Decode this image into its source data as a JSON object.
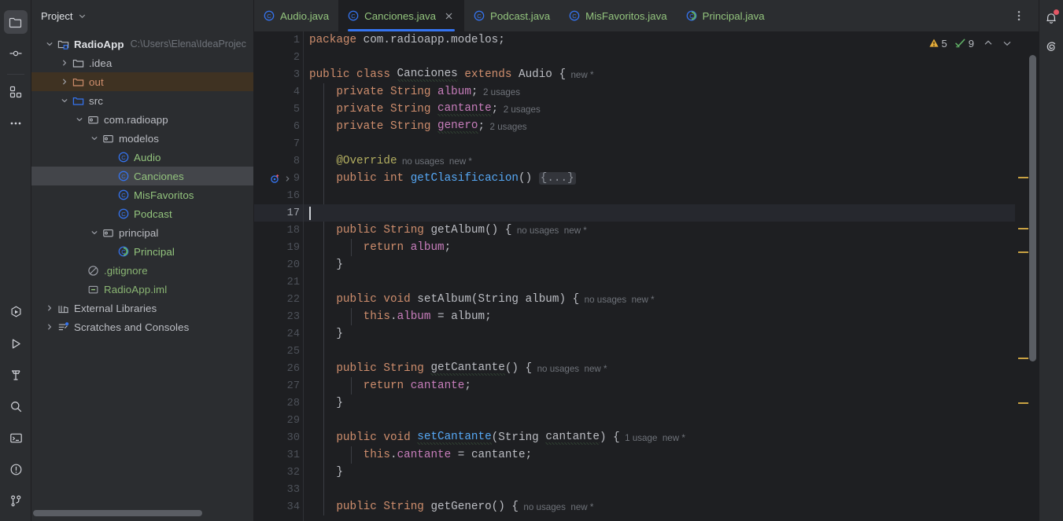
{
  "activity_bar": {
    "top": [
      {
        "name": "project-icon",
        "label": "Project"
      },
      {
        "name": "commit-icon",
        "label": "Commit"
      },
      {
        "name": "plugins-icon",
        "label": "Plugins"
      },
      {
        "name": "more-tool-windows-icon",
        "label": "More Tool Windows"
      }
    ],
    "bottom": [
      {
        "name": "run-with-coverage-icon",
        "label": "Run with Coverage"
      },
      {
        "name": "run-icon",
        "label": "Run"
      },
      {
        "name": "build-icon",
        "label": "Build"
      },
      {
        "name": "search-everywhere-icon",
        "label": "Search"
      },
      {
        "name": "terminal-icon",
        "label": "Terminal"
      },
      {
        "name": "problems-icon",
        "label": "Problems"
      },
      {
        "name": "version-control-icon",
        "label": "Version Control"
      }
    ]
  },
  "project_panel": {
    "title": "Project",
    "tree": [
      {
        "depth": 0,
        "arrow": "down",
        "icon": "module-icon",
        "label": "RadioApp",
        "style": "bold",
        "path": "C:\\Users\\Elena\\IdeaProjec",
        "state": "normal"
      },
      {
        "depth": 1,
        "arrow": "right",
        "icon": "folder-icon",
        "label": ".idea",
        "style": "plain",
        "state": "normal"
      },
      {
        "depth": 1,
        "arrow": "right",
        "icon": "folder-orange-icon",
        "label": "out",
        "style": "orange",
        "state": "highlight"
      },
      {
        "depth": 1,
        "arrow": "down",
        "icon": "folder-blue-icon",
        "label": "src",
        "style": "plain",
        "state": "normal"
      },
      {
        "depth": 2,
        "arrow": "down",
        "icon": "package-icon",
        "label": "com.radioapp",
        "style": "plain",
        "state": "normal"
      },
      {
        "depth": 3,
        "arrow": "down",
        "icon": "package-icon",
        "label": "modelos",
        "style": "plain",
        "state": "normal"
      },
      {
        "depth": 4,
        "arrow": "none",
        "icon": "class-icon",
        "label": "Audio",
        "style": "green",
        "state": "normal"
      },
      {
        "depth": 4,
        "arrow": "none",
        "icon": "class-icon",
        "label": "Canciones",
        "style": "green",
        "state": "selected"
      },
      {
        "depth": 4,
        "arrow": "none",
        "icon": "class-icon",
        "label": "MisFavoritos",
        "style": "green",
        "state": "normal"
      },
      {
        "depth": 4,
        "arrow": "none",
        "icon": "class-icon",
        "label": "Podcast",
        "style": "green",
        "state": "normal"
      },
      {
        "depth": 3,
        "arrow": "down",
        "icon": "package-icon",
        "label": "principal",
        "style": "plain",
        "state": "normal"
      },
      {
        "depth": 4,
        "arrow": "none",
        "icon": "runnable-class-icon",
        "label": "Principal",
        "style": "green",
        "state": "normal"
      },
      {
        "depth": 2,
        "arrow": "none",
        "icon": "gitignore-icon",
        "label": ".gitignore",
        "style": "green2",
        "state": "normal"
      },
      {
        "depth": 2,
        "arrow": "none",
        "icon": "iml-icon",
        "label": "RadioApp.iml",
        "style": "green2",
        "state": "normal"
      },
      {
        "depth": 0,
        "arrow": "right",
        "icon": "libraries-icon",
        "label": "External Libraries",
        "style": "plain",
        "state": "normal"
      },
      {
        "depth": 0,
        "arrow": "right",
        "icon": "scratches-icon",
        "label": "Scratches and Consoles",
        "style": "plain",
        "state": "normal"
      }
    ]
  },
  "editor": {
    "tabs": [
      {
        "label": "Audio.java",
        "icon": "class-icon",
        "active": false,
        "closable": false
      },
      {
        "label": "Canciones.java",
        "icon": "class-icon",
        "active": true,
        "closable": true
      },
      {
        "label": "Podcast.java",
        "icon": "class-icon",
        "active": false,
        "closable": false
      },
      {
        "label": "MisFavoritos.java",
        "icon": "class-icon",
        "active": false,
        "closable": false
      },
      {
        "label": "Principal.java",
        "icon": "runnable-class-icon",
        "active": false,
        "closable": false
      }
    ],
    "more_tabs_label": "⋮",
    "inspections": {
      "warning_count": "5",
      "weak_warning_count": "9",
      "prev_label": "Previous highlighted error",
      "next_label": "Next highlighted error"
    },
    "current_line": 17,
    "lines": [
      {
        "n": "1",
        "tokens": [
          {
            "t": "package ",
            "c": "kw"
          },
          {
            "t": "com.radioapp.modelos;",
            "c": "pl"
          }
        ]
      },
      {
        "n": "2",
        "tokens": []
      },
      {
        "n": "3",
        "tokens": [
          {
            "t": "public class ",
            "c": "kw"
          },
          {
            "t": "Canciones",
            "c": "pl",
            "squiggle": true
          },
          {
            "t": " extends ",
            "c": "kw"
          },
          {
            "t": "Audio {",
            "c": "pl"
          },
          {
            "t": "  new *",
            "c": "hint"
          }
        ]
      },
      {
        "n": "4",
        "indent": 1,
        "tokens": [
          {
            "t": "    private String ",
            "c": "kw"
          },
          {
            "t": "album",
            "c": "fld"
          },
          {
            "t": ";",
            "c": "pl"
          },
          {
            "t": "  2 usages",
            "c": "hint"
          }
        ]
      },
      {
        "n": "5",
        "indent": 1,
        "tokens": [
          {
            "t": "    private String ",
            "c": "kw"
          },
          {
            "t": "cantante",
            "c": "fld",
            "squiggle": true
          },
          {
            "t": ";",
            "c": "pl"
          },
          {
            "t": "  2 usages",
            "c": "hint"
          }
        ]
      },
      {
        "n": "6",
        "indent": 1,
        "tokens": [
          {
            "t": "    private String ",
            "c": "kw"
          },
          {
            "t": "genero",
            "c": "fld",
            "squiggle": true
          },
          {
            "t": ";",
            "c": "pl"
          },
          {
            "t": "  2 usages",
            "c": "hint"
          }
        ]
      },
      {
        "n": "7",
        "indent": 1,
        "tokens": []
      },
      {
        "n": "8",
        "indent": 1,
        "tokens": [
          {
            "t": "    @Override",
            "c": "anno"
          },
          {
            "t": "  no usages  new *",
            "c": "hint"
          }
        ]
      },
      {
        "n": "9",
        "indent": 1,
        "gutter_icon": "override-method-icon",
        "fold": true,
        "tokens": [
          {
            "t": "    public int ",
            "c": "kw"
          },
          {
            "t": "getClasificacion",
            "c": "fn"
          },
          {
            "t": "() ",
            "c": "pl"
          },
          {
            "t": "{...}",
            "c": "foldmark"
          }
        ]
      },
      {
        "n": "16",
        "indent": 1,
        "tokens": []
      },
      {
        "n": "17",
        "indent": 0,
        "caret": true,
        "tokens": []
      },
      {
        "n": "18",
        "indent": 1,
        "tokens": [
          {
            "t": "    public String ",
            "c": "kw"
          },
          {
            "t": "getAlbum",
            "c": "fnd"
          },
          {
            "t": "() {",
            "c": "pl"
          },
          {
            "t": "  no usages  new *",
            "c": "hint"
          }
        ]
      },
      {
        "n": "19",
        "indent": 2,
        "tokens": [
          {
            "t": "        return ",
            "c": "kw"
          },
          {
            "t": "album",
            "c": "fld"
          },
          {
            "t": ";",
            "c": "pl"
          }
        ]
      },
      {
        "n": "20",
        "indent": 1,
        "tokens": [
          {
            "t": "    }",
            "c": "pl"
          }
        ]
      },
      {
        "n": "21",
        "indent": 1,
        "tokens": []
      },
      {
        "n": "22",
        "indent": 1,
        "tokens": [
          {
            "t": "    public void ",
            "c": "kw"
          },
          {
            "t": "setAlbum",
            "c": "fnd"
          },
          {
            "t": "(",
            "c": "pl"
          },
          {
            "t": "String album",
            "c": "pl"
          },
          {
            "t": ") {",
            "c": "pl"
          },
          {
            "t": "  no usages  new *",
            "c": "hint"
          }
        ]
      },
      {
        "n": "23",
        "indent": 2,
        "tokens": [
          {
            "t": "        this",
            "c": "kw"
          },
          {
            "t": ".",
            "c": "pl"
          },
          {
            "t": "album",
            "c": "fld"
          },
          {
            "t": " = album;",
            "c": "pl"
          }
        ]
      },
      {
        "n": "24",
        "indent": 1,
        "tokens": [
          {
            "t": "    }",
            "c": "pl"
          }
        ]
      },
      {
        "n": "25",
        "indent": 1,
        "tokens": []
      },
      {
        "n": "26",
        "indent": 1,
        "tokens": [
          {
            "t": "    public String ",
            "c": "kw"
          },
          {
            "t": "getCantante",
            "c": "fnd",
            "squiggle": true
          },
          {
            "t": "() {",
            "c": "pl"
          },
          {
            "t": "  no usages  new *",
            "c": "hint"
          }
        ]
      },
      {
        "n": "27",
        "indent": 2,
        "tokens": [
          {
            "t": "        return ",
            "c": "kw"
          },
          {
            "t": "cantante",
            "c": "fld"
          },
          {
            "t": ";",
            "c": "pl"
          }
        ]
      },
      {
        "n": "28",
        "indent": 1,
        "tokens": [
          {
            "t": "    }",
            "c": "pl"
          }
        ]
      },
      {
        "n": "29",
        "indent": 1,
        "tokens": []
      },
      {
        "n": "30",
        "indent": 1,
        "tokens": [
          {
            "t": "    public void ",
            "c": "kw"
          },
          {
            "t": "setCantante",
            "c": "fn",
            "squiggle": true
          },
          {
            "t": "(",
            "c": "pl"
          },
          {
            "t": "String ",
            "c": "pl"
          },
          {
            "t": "cantante",
            "c": "pl",
            "squiggle": true
          },
          {
            "t": ") {",
            "c": "pl"
          },
          {
            "t": "  1 usage  new *",
            "c": "hint"
          }
        ]
      },
      {
        "n": "31",
        "indent": 2,
        "tokens": [
          {
            "t": "        this",
            "c": "kw"
          },
          {
            "t": ".",
            "c": "pl"
          },
          {
            "t": "cantante",
            "c": "fld"
          },
          {
            "t": " = cantante;",
            "c": "pl"
          }
        ]
      },
      {
        "n": "32",
        "indent": 1,
        "tokens": [
          {
            "t": "    }",
            "c": "pl"
          }
        ]
      },
      {
        "n": "33",
        "indent": 1,
        "tokens": []
      },
      {
        "n": "34",
        "indent": 1,
        "tokens": [
          {
            "t": "    public String ",
            "c": "kw"
          },
          {
            "t": "getGenero",
            "c": "fnd"
          },
          {
            "t": "() {",
            "c": "pl"
          },
          {
            "t": "  no usages  new *",
            "c": "hint"
          }
        ]
      }
    ],
    "stripe_marks": [
      185,
      250,
      280,
      415,
      472
    ]
  },
  "right_bar": [
    {
      "name": "notifications-icon",
      "label": "Notifications",
      "badge": true
    },
    {
      "name": "ai-assistant-icon",
      "label": "AI Assistant",
      "badge": false
    }
  ],
  "colors": {
    "accent": "#3574f0",
    "warning": "#c9a243",
    "green_text": "#93c47d",
    "selection": "#43454a",
    "highlight_row": "#3f3222",
    "editor_bg": "#1e1f22",
    "panel_bg": "#2b2d30"
  }
}
